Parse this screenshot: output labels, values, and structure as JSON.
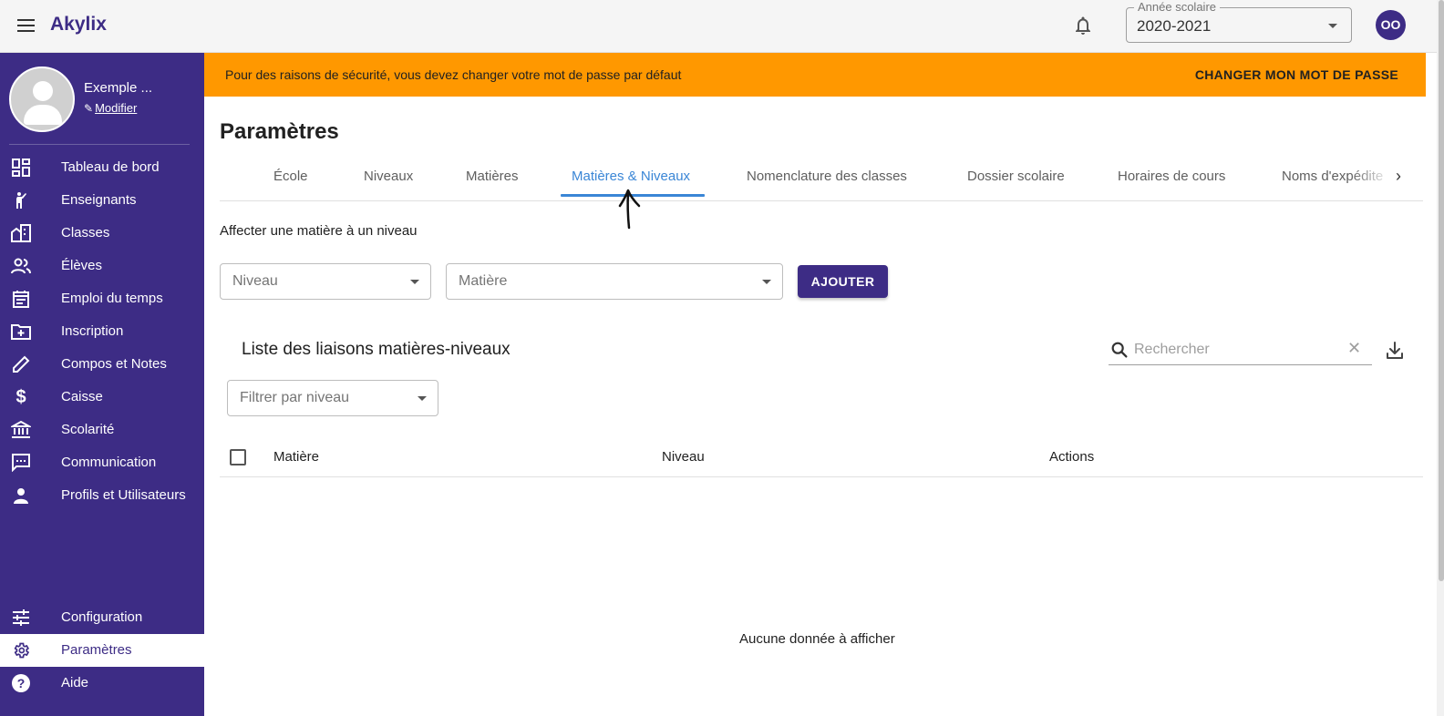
{
  "app": {
    "brand": "Akylix"
  },
  "topbar": {
    "year_label": "Année scolaire",
    "year_value": "2020-2021",
    "user_initials": "OO"
  },
  "sidebar": {
    "profile_name": "Exemple ...",
    "profile_edit": "Modifier",
    "items": [
      {
        "label": "Tableau de bord",
        "icon": "dashboard-icon"
      },
      {
        "label": "Enseignants",
        "icon": "teacher-icon"
      },
      {
        "label": "Classes",
        "icon": "building-icon"
      },
      {
        "label": "Élèves",
        "icon": "people-icon"
      },
      {
        "label": "Emploi du temps",
        "icon": "calendar-icon"
      },
      {
        "label": "Inscription",
        "icon": "folder-plus-icon"
      },
      {
        "label": "Compos et Notes",
        "icon": "pencil-icon"
      },
      {
        "label": "Caisse",
        "icon": "dollar-icon"
      },
      {
        "label": "Scolarité",
        "icon": "bank-icon"
      },
      {
        "label": "Communication",
        "icon": "chat-icon"
      },
      {
        "label": "Profils et Utilisateurs",
        "icon": "person-icon"
      }
    ],
    "bottom_items": [
      {
        "label": "Configuration",
        "icon": "sliders-icon"
      },
      {
        "label": "Paramètres",
        "icon": "gear-icon",
        "active": true
      },
      {
        "label": "Aide",
        "icon": "help-icon"
      }
    ]
  },
  "banner": {
    "text": "Pour des raisons de sécurité, vous devez changer votre mot de passe par défaut",
    "action": "CHANGER MON MOT DE PASSE",
    "color": "#ff9800"
  },
  "main": {
    "title": "Paramètres",
    "tabs": [
      {
        "label": "École"
      },
      {
        "label": "Niveaux"
      },
      {
        "label": "Matières"
      },
      {
        "label": "Matières & Niveaux",
        "active": true
      },
      {
        "label": "Nomenclature des classes"
      },
      {
        "label": "Dossier scolaire"
      },
      {
        "label": "Horaires de cours"
      },
      {
        "label": "Noms d'expédite"
      }
    ],
    "assign_label": "Affecter une matière à un niveau",
    "niveau_placeholder": "Niveau",
    "matiere_placeholder": "Matière",
    "add_button": "AJOUTER",
    "list_title": "Liste des liaisons matières-niveaux",
    "search_placeholder": "Rechercher",
    "filter_placeholder": "Filtrer par niveau",
    "columns": [
      "Matière",
      "Niveau",
      "Actions"
    ],
    "empty_text": "Aucune donnée à afficher"
  },
  "colors": {
    "primary": "#3d2c85",
    "accent_tab": "#3a86d6",
    "warning": "#ff9800"
  }
}
